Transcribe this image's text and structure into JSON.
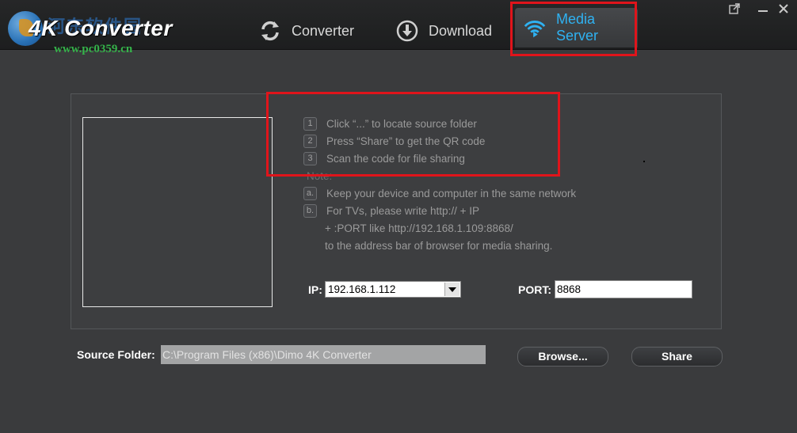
{
  "app": {
    "name": "4K Converter",
    "watermark_url": "www.pc0359.cn",
    "watermark_cn": "河东软件园"
  },
  "tabs": [
    {
      "label": "Converter",
      "icon": "refresh-icon"
    },
    {
      "label": "Download",
      "icon": "download-icon"
    },
    {
      "label": "Media Server",
      "icon": "wifi-icon",
      "active": true
    }
  ],
  "instructions": {
    "steps": [
      {
        "num": "1",
        "text": "Click “...” to locate source folder"
      },
      {
        "num": "2",
        "text": "Press “Share” to get the QR code"
      },
      {
        "num": "3",
        "text": "Scan the code for file sharing"
      }
    ],
    "note_label": "Note:",
    "notes": [
      {
        "num": "a.",
        "text": "Keep your device and computer in the same network"
      },
      {
        "num": "b.",
        "text": "For TVs, please write http:// + IP"
      }
    ],
    "note_b_cont1": "+ :PORT like http://192.168.1.109:8868/",
    "note_b_cont2": "to the address bar of browser for media sharing."
  },
  "network": {
    "ip_label": "IP:",
    "ip_value": "192.168.1.112",
    "port_label": "PORT:",
    "port_value": "8868"
  },
  "source": {
    "label": "Source Folder:",
    "path": "C:\\Program Files (x86)\\Dimo 4K Converter"
  },
  "buttons": {
    "browse": "Browse...",
    "share": "Share"
  },
  "colors": {
    "accent": "#2fb2f2",
    "highlight": "#e0141b",
    "background": "#3a3b3d"
  }
}
